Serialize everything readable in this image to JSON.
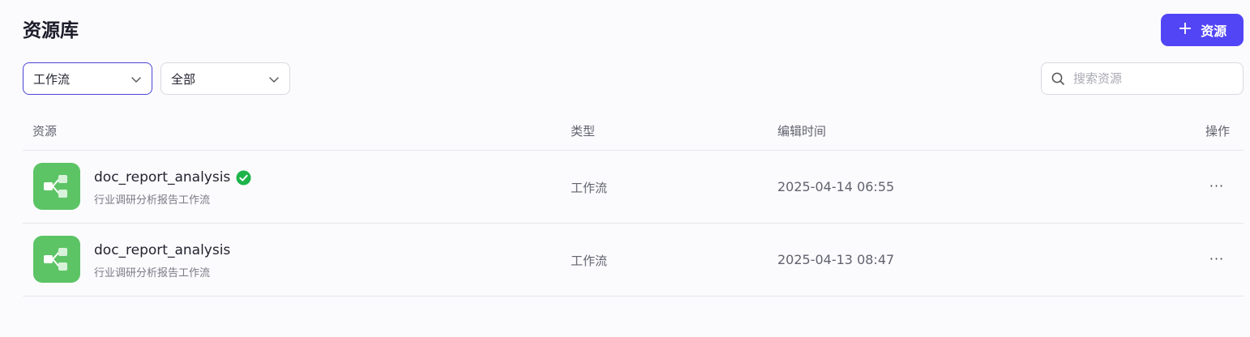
{
  "header": {
    "title": "资源库",
    "add_button": {
      "icon": "plus-icon",
      "label": "资源"
    }
  },
  "filters": {
    "type_select": {
      "value": "工作流"
    },
    "scope_select": {
      "value": "全部"
    },
    "search": {
      "placeholder": "搜索资源",
      "value": ""
    }
  },
  "table": {
    "columns": [
      "资源",
      "类型",
      "编辑时间",
      "操作"
    ],
    "rows": [
      {
        "icon": "workflow-icon",
        "name": "doc_report_analysis",
        "verified": true,
        "description": "行业调研分析报告工作流",
        "type": "工作流",
        "edited": "2025-04-14 06:55",
        "action": "···"
      },
      {
        "icon": "workflow-icon",
        "name": "doc_report_analysis",
        "verified": false,
        "description": "行业调研分析报告工作流",
        "type": "工作流",
        "edited": "2025-04-13 08:47",
        "action": "···"
      }
    ]
  },
  "colors": {
    "accent": "#5245f5",
    "workflow_icon_bg": "#5dc466",
    "verified_badge": "#1db44a"
  }
}
